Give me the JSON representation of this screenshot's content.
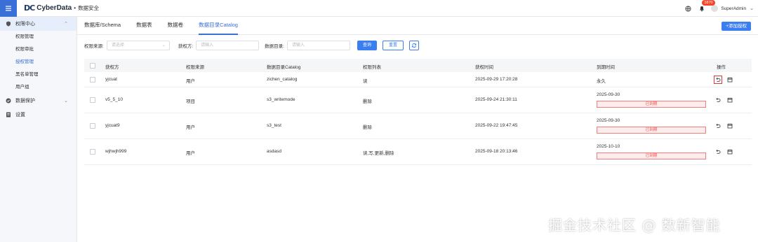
{
  "app": {
    "logo_mark": "DC",
    "name": "CyberData",
    "separator": "•",
    "section": "数据安全"
  },
  "topbar": {
    "notification_count": "1870",
    "username": "SuperAdmin",
    "icons": [
      "menu-icon",
      "globe-icon",
      "bell-icon",
      "chevron-down-icon"
    ]
  },
  "sidebar": {
    "groups": [
      {
        "label": "权限中心",
        "icon": "shield-icon",
        "expanded": true,
        "items": [
          "权限管理",
          "权限审批",
          "授权管理",
          "黑名单管理",
          "用户组"
        ],
        "active_item": "授权管理"
      },
      {
        "label": "数据保护",
        "icon": "shield-check-icon",
        "expanded": false
      },
      {
        "label": "设置",
        "icon": "settings-doc-icon"
      }
    ]
  },
  "tabs": [
    "数据库/Schema",
    "数据表",
    "数据卷",
    "数据目录Catalog"
  ],
  "active_tab": "数据目录Catalog",
  "add_button": "+添加授权",
  "filters": {
    "source_label": "权限来源:",
    "source_placeholder": "请选择",
    "grantee_label": "获权方:",
    "grantee_placeholder": "请输入",
    "catalog_label": "数据目录:",
    "catalog_placeholder": "请输入",
    "query_button": "查询",
    "reset_button": "重置"
  },
  "table": {
    "columns": [
      "获权方",
      "权限来源",
      "数据目录Catalog",
      "权限列表",
      "获权时间",
      "到期时间",
      "操作"
    ],
    "rows": [
      {
        "grantee": "yjcuat",
        "source": "用户",
        "catalog": "zichen_catalog",
        "perms": "读",
        "granted": "2025-09-29 17:20:28",
        "expire": "永久",
        "expired_label": ""
      },
      {
        "grantee": "v5_5_10",
        "source": "项目",
        "catalog": "s3_writemode",
        "perms": "删除",
        "granted": "2025-09-24 21:30:11",
        "expire": "2025-09-30",
        "expired_label": "已到期"
      },
      {
        "grantee": "yjcuat9",
        "source": "用户",
        "catalog": "s3_test",
        "perms": "删除",
        "granted": "2025-09-22 19:47:45",
        "expire": "2025-09-30",
        "expired_label": "已到期"
      },
      {
        "grantee": "wjhwjh999",
        "source": "用户",
        "catalog": "asdasd",
        "perms": "读,写,更新,删除",
        "granted": "2025-09-18 20:13:46",
        "expire": "2025-10-10",
        "expired_label": "已到期"
      }
    ]
  },
  "watermark": "掘金技术社区 @ 数新智能",
  "colors": {
    "primary": "#3a7ef0",
    "expired_border": "#f08080",
    "expired_text": "#f04848",
    "badge": "#f5442b"
  }
}
